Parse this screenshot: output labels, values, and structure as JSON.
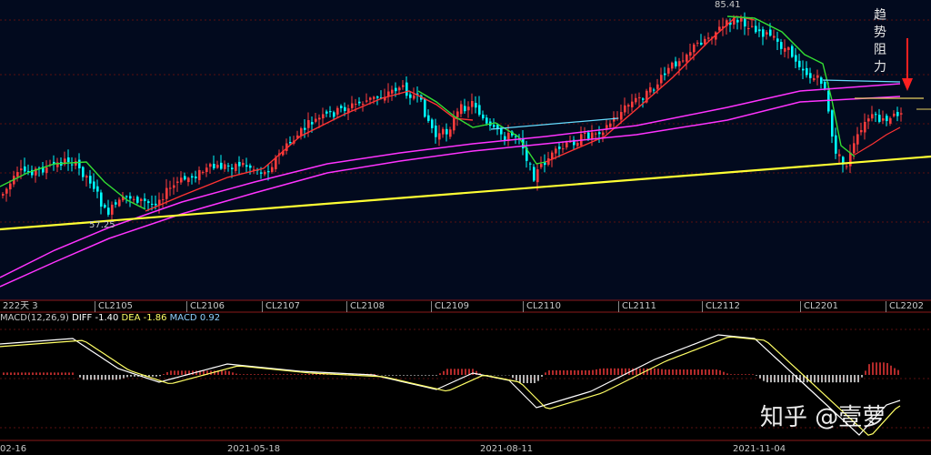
{
  "chart_data": [
    {
      "type": "candlestick",
      "title": "",
      "x_labels": [
        "222天 3",
        "CL2105",
        "CL2106",
        "CL2107",
        "CL2108",
        "CL2109",
        "CL2110",
        "CL2111",
        "CL2112",
        "CL2201",
        "CL2202"
      ],
      "date_labels": [
        "02-16",
        "2021-05-18",
        "2021-08-11",
        "2021-11-04"
      ],
      "annotations": {
        "high": "85.41",
        "low": "57.25",
        "note": "趋势阻力"
      },
      "approx_price_range": [
        55,
        86
      ],
      "colors": {
        "up": "#ff3c3c",
        "down": "#00ffff",
        "ma_fast": "#ff3333",
        "ma_mid": "#33dd33",
        "ma_long": "#ff33ff",
        "trendline": "#ffff33",
        "resistance": "#66ddff"
      }
    },
    {
      "type": "macd",
      "header": {
        "name": "MACD(12,26,9)",
        "diff_label": "DIFF",
        "diff": "-1.40",
        "dea_label": "DEA",
        "dea": "-1.86",
        "macd_label": "MACD",
        "macd": "0.92"
      },
      "colors": {
        "diff": "#ffffff",
        "dea": "#ffff66",
        "positive": "#ff3c3c",
        "negative": "#ffffff"
      }
    }
  ],
  "watermark": "知乎 @壹萝"
}
